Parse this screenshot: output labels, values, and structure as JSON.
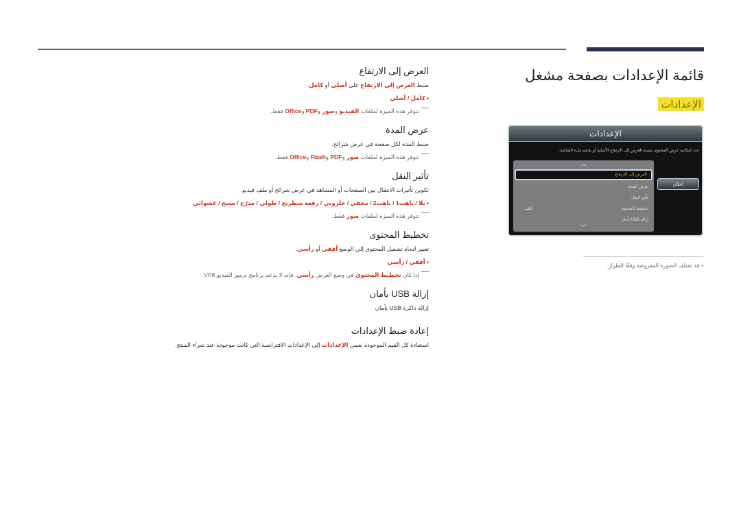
{
  "header": {
    "title": "قائمة الإعدادات بصفحة مشغل",
    "section_tag": "الإعدادات"
  },
  "colors": {
    "accent_red": "#d0331b",
    "highlight_yellow": "#f3df2c",
    "rule_navy": "#2c3150"
  },
  "dialog": {
    "title": "الإعدادات",
    "description": "حدد إمكانية عرض المحتوى بنسبة العرض إلى الارتفاع الأصلية أو بحجم ملء الشاشة.",
    "up_icon": "chevron-up-icon",
    "down_icon": "chevron-down-icon",
    "items": [
      {
        "label": "العرض إلى الارتفاع",
        "value": "",
        "selected": true
      },
      {
        "label": "عرض المدة",
        "value": "",
        "selected": false
      },
      {
        "label": "تأثير النقل",
        "value": "",
        "selected": false
      },
      {
        "label": "تخطيط المحتوى",
        "value": "أفقي",
        "selected": false
      },
      {
        "label": "إزالة USB بأمان",
        "value": "",
        "selected": false
      }
    ],
    "close_label": "إغلاق"
  },
  "image_note": "– قد تختلف الصورة المعروضة وفقًا للطراز.",
  "sections": [
    {
      "title": "العرض إلى الارتفاع",
      "desc": {
        "p1": "ضبط ",
        "h1": "العرض إلى الارتفاع",
        "p2": " على ",
        "h2": "أصلي",
        "p3": " أو ",
        "h3": "كامل",
        "p4": "."
      },
      "options": "كامل / أصلي",
      "note": {
        "p1": "تتوفر هذه الميزة لملفات ",
        "h1": "الفيديو",
        "p2": " و",
        "h2": "صور",
        "p3": " و",
        "h3": "PDF",
        "p4": " و",
        "h4": "Office",
        "p5": " فقط."
      }
    },
    {
      "title": "عرض المدة",
      "desc_text": "ضبط المدة لكل صفحة في عرض شرائح.",
      "note": {
        "p1": "تتوفر هذه الميزة لملفات ",
        "h1": "صور",
        "p2": " و",
        "h2": "PDF",
        "p3": " و",
        "h3": "Flash",
        "p4": " و",
        "h4": "Office",
        "p5": " فقط."
      }
    },
    {
      "title": "تأثير النقل",
      "desc_text": "تكوين تأثيرات الانتقال بين الصفحات أو المشاهد في عرض شرائح أو ملف فيديو.",
      "options": "بلا / باهت1 / باهت2 / مخفي / حلزوني / رقعة شطرنج / طولي / مدرّج / مسح / عشوائي",
      "note": {
        "p1": "تتوفر هذه الميزة لملفات ",
        "h1": "صور",
        "p2": " فقط."
      }
    },
    {
      "title": "تخطيط المحتوى",
      "desc": {
        "p1": "تغيير اتجاه تشغيل المحتوى إلى الوضع ",
        "h1": "أفقي",
        "p2": " أو ",
        "h2": "رأسي",
        "p3": "."
      },
      "options": "أفقي / رأسي",
      "note": {
        "p1": "إذا كان ",
        "h1": "تخطيط المحتوى",
        "p2": " في وضع العرض ",
        "h2": "رأسي",
        "p3": "، فإنه لا يدعم برنامج ترميز الفيديو VP8."
      }
    },
    {
      "title": "إزالة USB بأمان",
      "desc_text": "إزالة ذاكرة USB بأمان"
    },
    {
      "title": "إعادة ضبط الإعدادات",
      "desc": {
        "p1": "استعادة كل القيم الموجودة ضمن ",
        "h1": "الإعدادات",
        "p2": " إلى الإعدادات الافتراضية التي كانت موجودة عند شراء المنتج."
      }
    }
  ]
}
